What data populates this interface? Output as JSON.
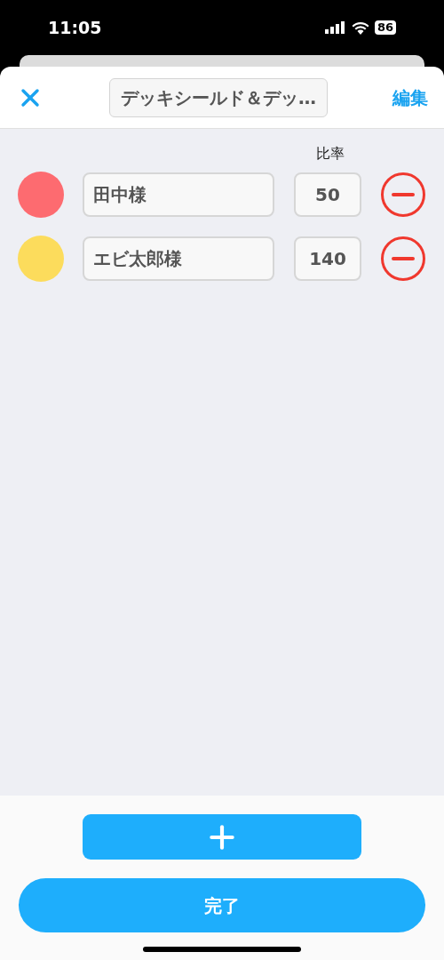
{
  "status_bar": {
    "time": "11:05",
    "battery": "86"
  },
  "header": {
    "title": "デッキシールド＆デッ…",
    "edit": "編集"
  },
  "column_header": "比率",
  "members": [
    {
      "name": "田中様",
      "ratio": "50",
      "color": "#fd6b70"
    },
    {
      "name": "エビ太郎様",
      "ratio": "140",
      "color": "#fcdc5c"
    }
  ],
  "done_button": "完了"
}
